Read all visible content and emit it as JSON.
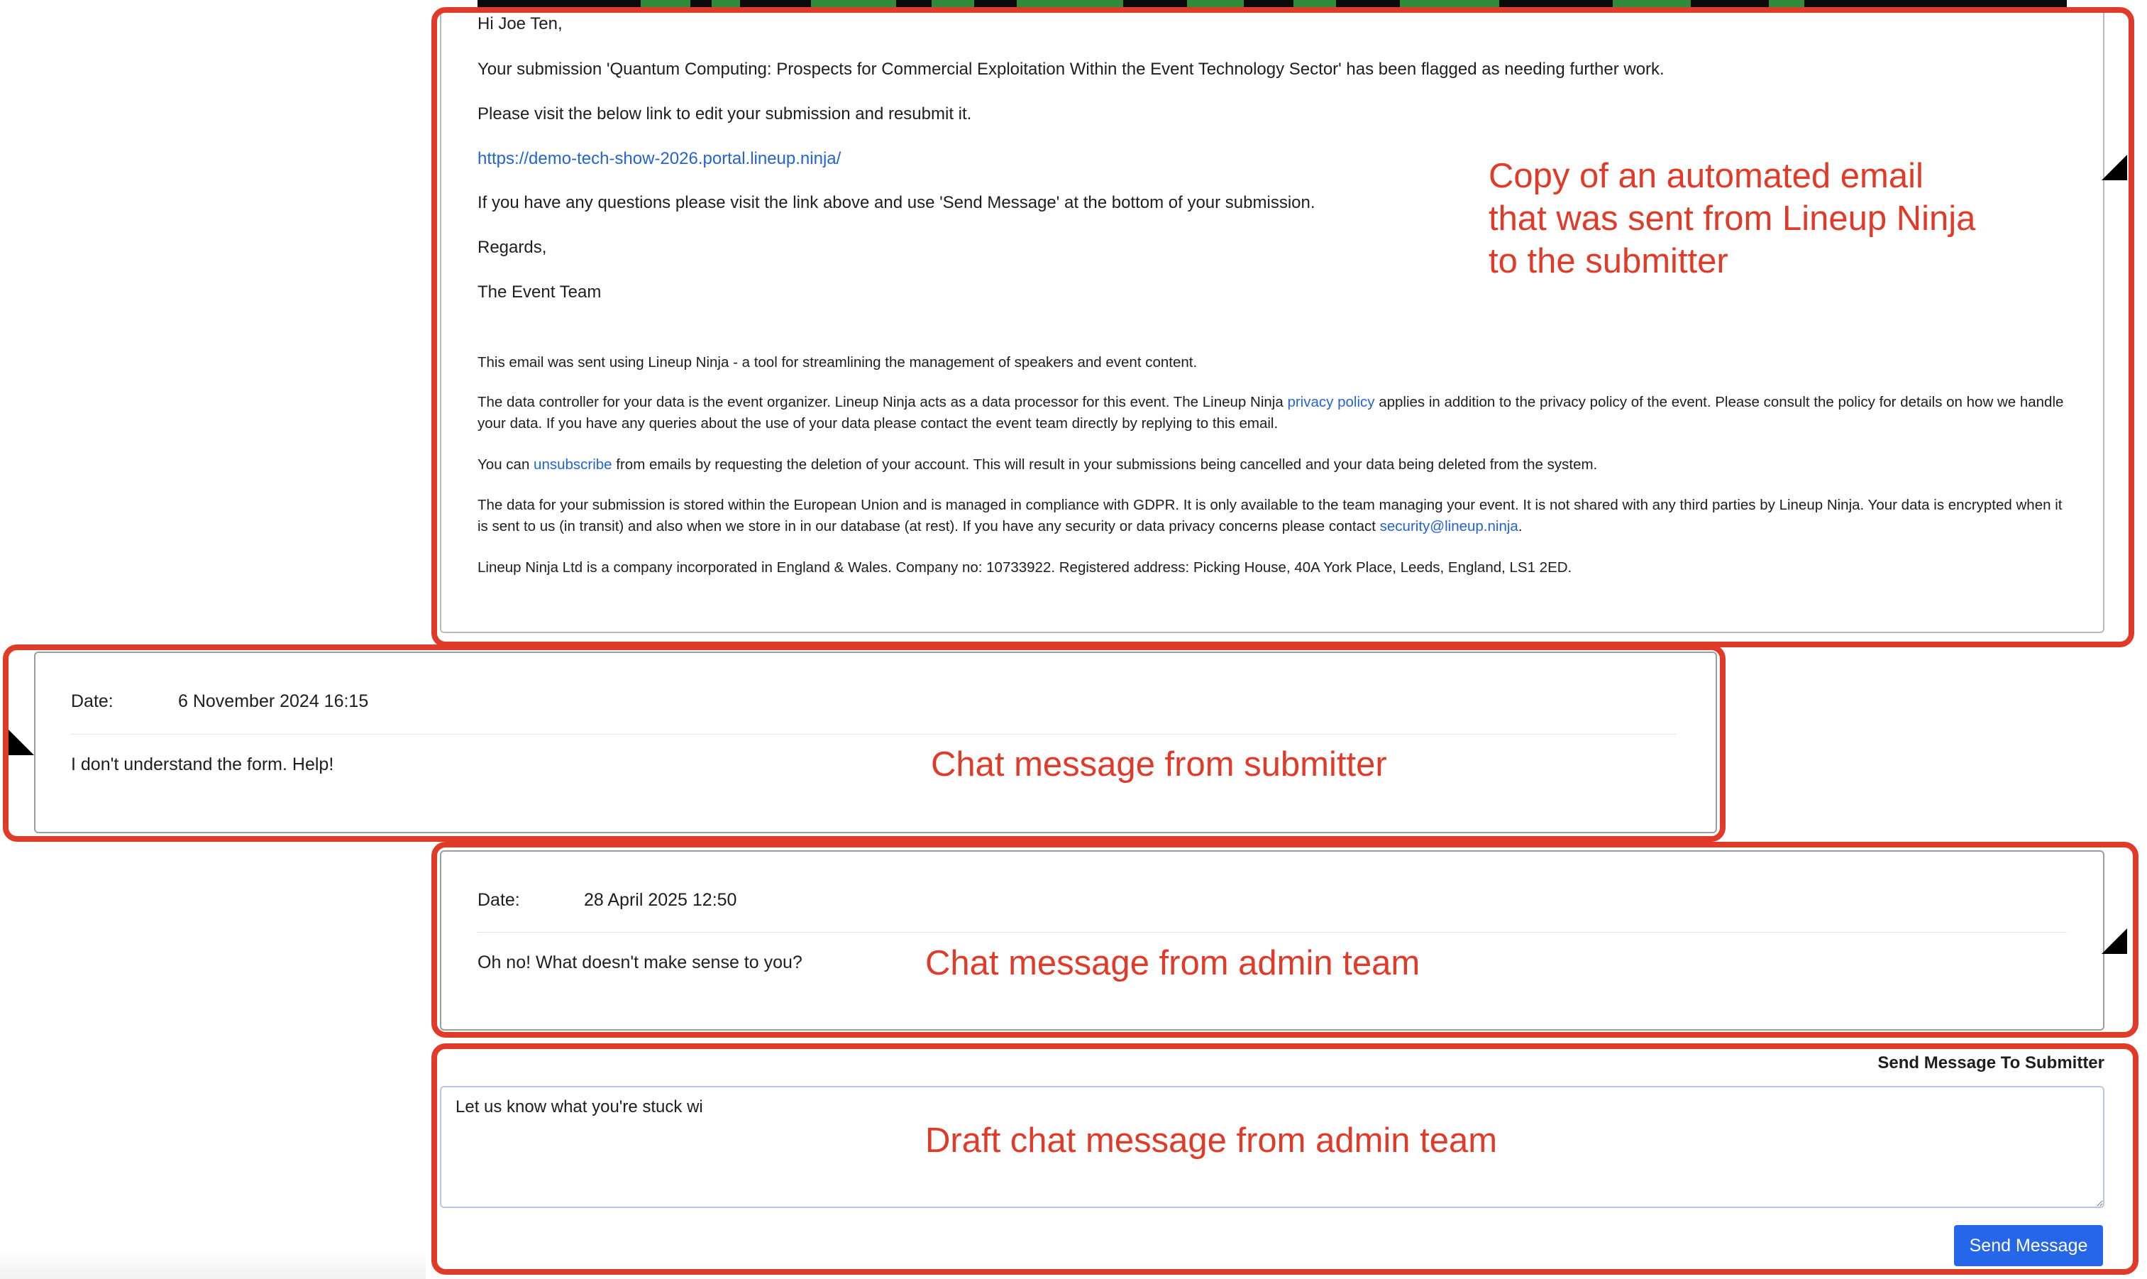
{
  "email": {
    "greeting": "Hi Joe Ten,",
    "line1": "Your submission 'Quantum Computing: Prospects for Commercial Exploitation Within the Event Technology Sector' has been flagged as needing further work.",
    "line2": "Please visit the below link to edit your submission and resubmit it.",
    "link": "https://demo-tech-show-2026.portal.lineup.ninja/",
    "line3": "If you have any questions please visit the link above and use 'Send Message' at the bottom of your submission.",
    "regards": "Regards,",
    "signature": "The Event Team",
    "footer": {
      "p1": "This email was sent using Lineup Ninja - a tool for streamlining the management of speakers and event content.",
      "p2_before": "The data controller for your data is the event organizer. Lineup Ninja acts as a data processor for this event. The Lineup Ninja ",
      "p2_link": "privacy policy",
      "p2_after": " applies in addition to the privacy policy of the event. Please consult the policy for details on how we handle your data. If you have any queries about the use of your data please contact the event team directly by replying to this email.",
      "p3_before": "You can ",
      "p3_link": "unsubscribe",
      "p3_after": " from emails by requesting the deletion of your account. This will result in your submissions being cancelled and your data being deleted from the system.",
      "p4_before": "The data for your submission is stored within the European Union and is managed in compliance with GDPR. It is only available to the team managing your event. It is not shared with any third parties by Lineup Ninja. Your data is encrypted when it is sent to us (in transit) and also when we store in in our database (at rest). If you have any security or data privacy concerns please contact ",
      "p4_link": "security@lineup.ninja",
      "p4_after": ".",
      "p5": "Lineup Ninja Ltd is a company incorporated in England & Wales. Company no: 10733922. Registered address: Picking House, 40A York Place, Leeds, England, LS1 2ED."
    }
  },
  "messages": [
    {
      "date_label": "Date:",
      "date_value": "6 November 2024 16:15",
      "body": "I don't understand the form. Help!"
    },
    {
      "date_label": "Date:",
      "date_value": "28 April 2025 12:50",
      "body": "Oh no! What doesn't make sense to you?"
    }
  ],
  "composer": {
    "label": "Send Message To Submitter",
    "draft": "Let us know what you're stuck wi",
    "send_label": "Send Message"
  },
  "annotations": {
    "email_line1": "Copy of an automated email",
    "email_line2": "that was sent from Lineup Ninja",
    "email_line3": "to the submitter",
    "submitter": "Chat message from submitter",
    "admin": "Chat message from admin team",
    "draft": "Draft chat message from admin team"
  },
  "colors": {
    "annotation": "#e03a28",
    "link": "#2463d6",
    "button": "#2567e8"
  }
}
